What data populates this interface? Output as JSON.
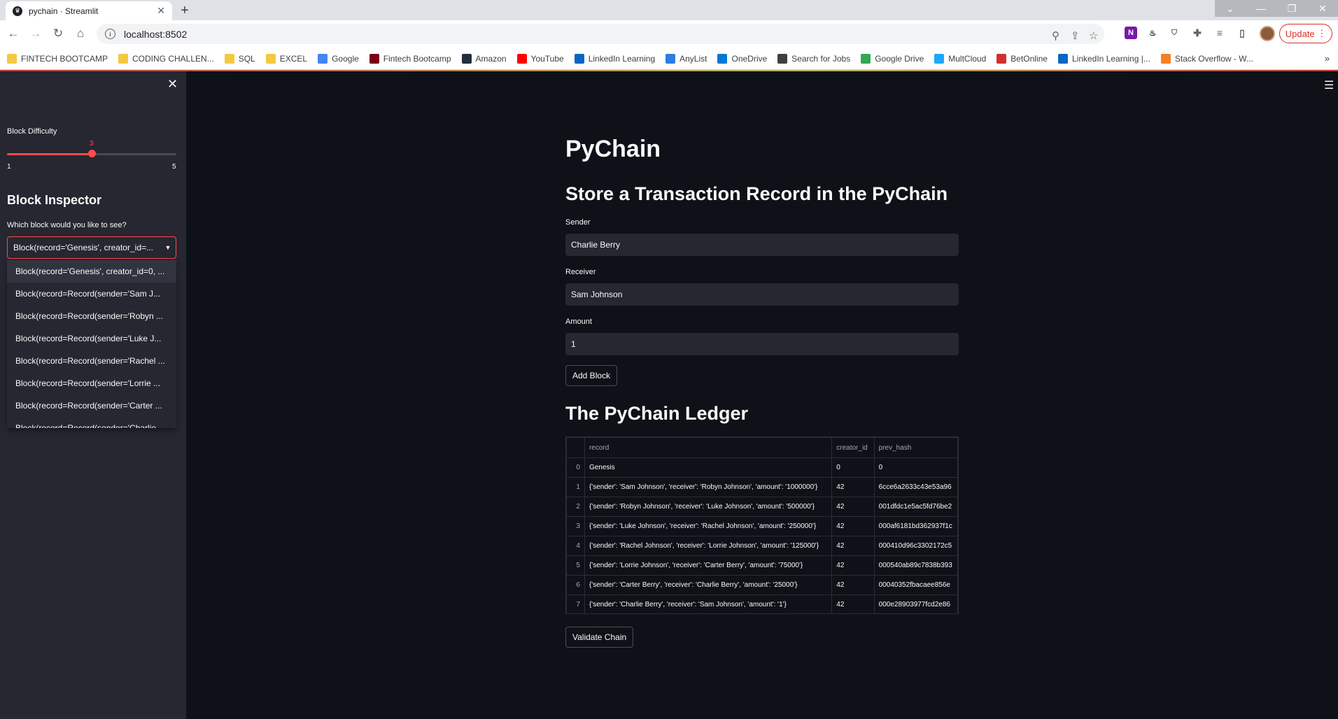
{
  "browser": {
    "tab_title": "pychain · Streamlit",
    "url": "localhost:8502",
    "update_label": "Update",
    "bookmarks": [
      {
        "label": "FINTECH BOOTCAMP",
        "color": "#f4c842"
      },
      {
        "label": "CODING CHALLEN...",
        "color": "#f4c842"
      },
      {
        "label": "SQL",
        "color": "#f4c842"
      },
      {
        "label": "EXCEL",
        "color": "#f4c842"
      },
      {
        "label": "Google",
        "color": "#4285f4"
      },
      {
        "label": "Fintech Bootcamp",
        "color": "#7a0019"
      },
      {
        "label": "Amazon",
        "color": "#232f3e"
      },
      {
        "label": "YouTube",
        "color": "#ff0000"
      },
      {
        "label": "LinkedIn Learning",
        "color": "#0a66c2"
      },
      {
        "label": "AnyList",
        "color": "#2a7de1"
      },
      {
        "label": "OneDrive",
        "color": "#0078d4"
      },
      {
        "label": "Search for Jobs",
        "color": "#3c4043"
      },
      {
        "label": "Google Drive",
        "color": "#34a853"
      },
      {
        "label": "MultCloud",
        "color": "#1ea7fd"
      },
      {
        "label": "BetOnline",
        "color": "#d32f2f"
      },
      {
        "label": "LinkedIn Learning |...",
        "color": "#0a66c2"
      },
      {
        "label": "Stack Overflow - W...",
        "color": "#f48024"
      }
    ]
  },
  "sidebar": {
    "difficulty_label": "Block Difficulty",
    "difficulty_value": "3",
    "difficulty_min": "1",
    "difficulty_max": "5",
    "inspector_heading": "Block Inspector",
    "select_label": "Which block would you like to see?",
    "selected": "Block(record='Genesis', creator_id=...",
    "options": [
      "Block(record='Genesis', creator_id=0, ...",
      "Block(record=Record(sender='Sam J...",
      "Block(record=Record(sender='Robyn ...",
      "Block(record=Record(sender='Luke J...",
      "Block(record=Record(sender='Rachel ...",
      "Block(record=Record(sender='Lorrie ...",
      "Block(record=Record(sender='Carter ...",
      "Block(record=Record(sender='Charlie..."
    ]
  },
  "main": {
    "title": "PyChain",
    "subtitle": "Store a Transaction Record in the PyChain",
    "sender_label": "Sender",
    "sender_value": "Charlie Berry",
    "receiver_label": "Receiver",
    "receiver_value": "Sam Johnson",
    "amount_label": "Amount",
    "amount_value": "1",
    "add_block_label": "Add Block",
    "ledger_heading": "The PyChain Ledger",
    "validate_label": "Validate Chain"
  },
  "ledger": {
    "columns": [
      "",
      "record",
      "creator_id",
      "prev_hash"
    ],
    "rows": [
      {
        "index": "0",
        "record": "Genesis",
        "creator_id": "0",
        "prev_hash": "0"
      },
      {
        "index": "1",
        "record": "{'sender': 'Sam Johnson', 'receiver': 'Robyn Johnson', 'amount': '1000000'}",
        "creator_id": "42",
        "prev_hash": "6cce6a2633c43e53a96"
      },
      {
        "index": "2",
        "record": "{'sender': 'Robyn Johnson', 'receiver': 'Luke Johnson', 'amount': '500000'}",
        "creator_id": "42",
        "prev_hash": "001dfdc1e5ac5fd76be2"
      },
      {
        "index": "3",
        "record": "{'sender': 'Luke Johnson', 'receiver': 'Rachel Johnson', 'amount': '250000'}",
        "creator_id": "42",
        "prev_hash": "000af6181bd362937f1c"
      },
      {
        "index": "4",
        "record": "{'sender': 'Rachel Johnson', 'receiver': 'Lorrie Johnson', 'amount': '125000'}",
        "creator_id": "42",
        "prev_hash": "000410d96c3302172c5"
      },
      {
        "index": "5",
        "record": "{'sender': 'Lorrie Johnson', 'receiver': 'Carter Berry', 'amount': '75000'}",
        "creator_id": "42",
        "prev_hash": "000540ab89c7838b393"
      },
      {
        "index": "6",
        "record": "{'sender': 'Carter Berry', 'receiver': 'Charlie Berry', 'amount': '25000'}",
        "creator_id": "42",
        "prev_hash": "00040352fbacaee856e"
      },
      {
        "index": "7",
        "record": "{'sender': 'Charlie Berry', 'receiver': 'Sam Johnson', 'amount': '1'}",
        "creator_id": "42",
        "prev_hash": "000e28903977fcd2e86"
      }
    ]
  }
}
